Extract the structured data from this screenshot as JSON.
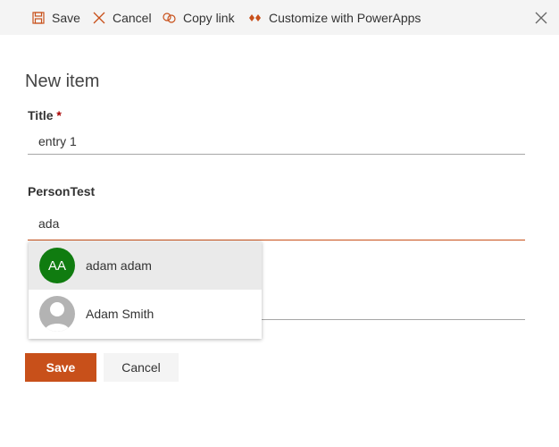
{
  "command_bar": {
    "save_label": "Save",
    "cancel_label": "Cancel",
    "copy_link_label": "Copy link",
    "customize_label": "Customize with PowerApps"
  },
  "form": {
    "title": "New item",
    "fields": [
      {
        "label": "Title",
        "required_marker": "*",
        "value": "entry 1"
      },
      {
        "label": "PersonTest",
        "value": "ada"
      }
    ]
  },
  "suggestions": [
    {
      "initials": "AA",
      "name": "adam adam",
      "avatar_color": "#107c10",
      "highlighted": true
    },
    {
      "initials": "",
      "name": "Adam Smith",
      "avatar_color": "#b3b3b3",
      "highlighted": false
    }
  ],
  "footer": {
    "save_label": "Save",
    "cancel_label": "Cancel"
  },
  "colors": {
    "accent": "#c8501a"
  }
}
